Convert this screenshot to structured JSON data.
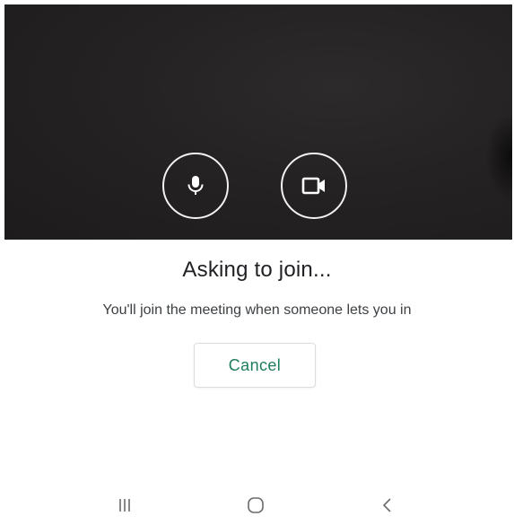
{
  "camera": {
    "mic_icon": "microphone-icon",
    "camera_icon": "video-camera-icon",
    "button_ring_color": "#f2f2f2",
    "background_color": "#242222"
  },
  "status": {
    "title": "Asking to join...",
    "subtitle": "You'll join the meeting when someone lets you in"
  },
  "actions": {
    "cancel_label": "Cancel",
    "cancel_color": "#1e7e5c"
  },
  "navigation": {
    "recents_icon": "recent-apps-icon",
    "home_icon": "home-icon",
    "back_icon": "back-icon"
  }
}
